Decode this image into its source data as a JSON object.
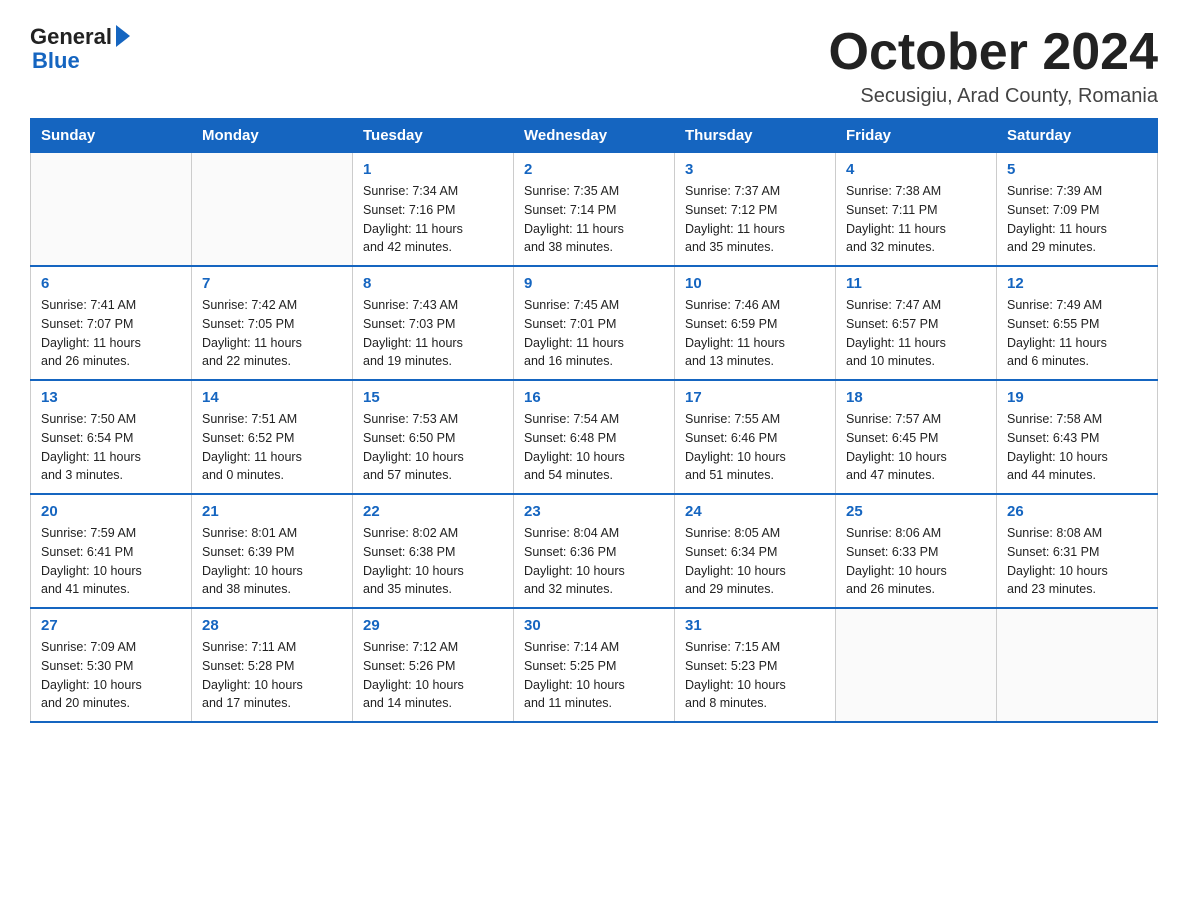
{
  "logo": {
    "general": "General",
    "blue": "Blue"
  },
  "title": "October 2024",
  "location": "Secusigiu, Arad County, Romania",
  "days_header": [
    "Sunday",
    "Monday",
    "Tuesday",
    "Wednesday",
    "Thursday",
    "Friday",
    "Saturday"
  ],
  "weeks": [
    [
      {
        "day": "",
        "info": ""
      },
      {
        "day": "",
        "info": ""
      },
      {
        "day": "1",
        "info": "Sunrise: 7:34 AM\nSunset: 7:16 PM\nDaylight: 11 hours\nand 42 minutes."
      },
      {
        "day": "2",
        "info": "Sunrise: 7:35 AM\nSunset: 7:14 PM\nDaylight: 11 hours\nand 38 minutes."
      },
      {
        "day": "3",
        "info": "Sunrise: 7:37 AM\nSunset: 7:12 PM\nDaylight: 11 hours\nand 35 minutes."
      },
      {
        "day": "4",
        "info": "Sunrise: 7:38 AM\nSunset: 7:11 PM\nDaylight: 11 hours\nand 32 minutes."
      },
      {
        "day": "5",
        "info": "Sunrise: 7:39 AM\nSunset: 7:09 PM\nDaylight: 11 hours\nand 29 minutes."
      }
    ],
    [
      {
        "day": "6",
        "info": "Sunrise: 7:41 AM\nSunset: 7:07 PM\nDaylight: 11 hours\nand 26 minutes."
      },
      {
        "day": "7",
        "info": "Sunrise: 7:42 AM\nSunset: 7:05 PM\nDaylight: 11 hours\nand 22 minutes."
      },
      {
        "day": "8",
        "info": "Sunrise: 7:43 AM\nSunset: 7:03 PM\nDaylight: 11 hours\nand 19 minutes."
      },
      {
        "day": "9",
        "info": "Sunrise: 7:45 AM\nSunset: 7:01 PM\nDaylight: 11 hours\nand 16 minutes."
      },
      {
        "day": "10",
        "info": "Sunrise: 7:46 AM\nSunset: 6:59 PM\nDaylight: 11 hours\nand 13 minutes."
      },
      {
        "day": "11",
        "info": "Sunrise: 7:47 AM\nSunset: 6:57 PM\nDaylight: 11 hours\nand 10 minutes."
      },
      {
        "day": "12",
        "info": "Sunrise: 7:49 AM\nSunset: 6:55 PM\nDaylight: 11 hours\nand 6 minutes."
      }
    ],
    [
      {
        "day": "13",
        "info": "Sunrise: 7:50 AM\nSunset: 6:54 PM\nDaylight: 11 hours\nand 3 minutes."
      },
      {
        "day": "14",
        "info": "Sunrise: 7:51 AM\nSunset: 6:52 PM\nDaylight: 11 hours\nand 0 minutes."
      },
      {
        "day": "15",
        "info": "Sunrise: 7:53 AM\nSunset: 6:50 PM\nDaylight: 10 hours\nand 57 minutes."
      },
      {
        "day": "16",
        "info": "Sunrise: 7:54 AM\nSunset: 6:48 PM\nDaylight: 10 hours\nand 54 minutes."
      },
      {
        "day": "17",
        "info": "Sunrise: 7:55 AM\nSunset: 6:46 PM\nDaylight: 10 hours\nand 51 minutes."
      },
      {
        "day": "18",
        "info": "Sunrise: 7:57 AM\nSunset: 6:45 PM\nDaylight: 10 hours\nand 47 minutes."
      },
      {
        "day": "19",
        "info": "Sunrise: 7:58 AM\nSunset: 6:43 PM\nDaylight: 10 hours\nand 44 minutes."
      }
    ],
    [
      {
        "day": "20",
        "info": "Sunrise: 7:59 AM\nSunset: 6:41 PM\nDaylight: 10 hours\nand 41 minutes."
      },
      {
        "day": "21",
        "info": "Sunrise: 8:01 AM\nSunset: 6:39 PM\nDaylight: 10 hours\nand 38 minutes."
      },
      {
        "day": "22",
        "info": "Sunrise: 8:02 AM\nSunset: 6:38 PM\nDaylight: 10 hours\nand 35 minutes."
      },
      {
        "day": "23",
        "info": "Sunrise: 8:04 AM\nSunset: 6:36 PM\nDaylight: 10 hours\nand 32 minutes."
      },
      {
        "day": "24",
        "info": "Sunrise: 8:05 AM\nSunset: 6:34 PM\nDaylight: 10 hours\nand 29 minutes."
      },
      {
        "day": "25",
        "info": "Sunrise: 8:06 AM\nSunset: 6:33 PM\nDaylight: 10 hours\nand 26 minutes."
      },
      {
        "day": "26",
        "info": "Sunrise: 8:08 AM\nSunset: 6:31 PM\nDaylight: 10 hours\nand 23 minutes."
      }
    ],
    [
      {
        "day": "27",
        "info": "Sunrise: 7:09 AM\nSunset: 5:30 PM\nDaylight: 10 hours\nand 20 minutes."
      },
      {
        "day": "28",
        "info": "Sunrise: 7:11 AM\nSunset: 5:28 PM\nDaylight: 10 hours\nand 17 minutes."
      },
      {
        "day": "29",
        "info": "Sunrise: 7:12 AM\nSunset: 5:26 PM\nDaylight: 10 hours\nand 14 minutes."
      },
      {
        "day": "30",
        "info": "Sunrise: 7:14 AM\nSunset: 5:25 PM\nDaylight: 10 hours\nand 11 minutes."
      },
      {
        "day": "31",
        "info": "Sunrise: 7:15 AM\nSunset: 5:23 PM\nDaylight: 10 hours\nand 8 minutes."
      },
      {
        "day": "",
        "info": ""
      },
      {
        "day": "",
        "info": ""
      }
    ]
  ]
}
